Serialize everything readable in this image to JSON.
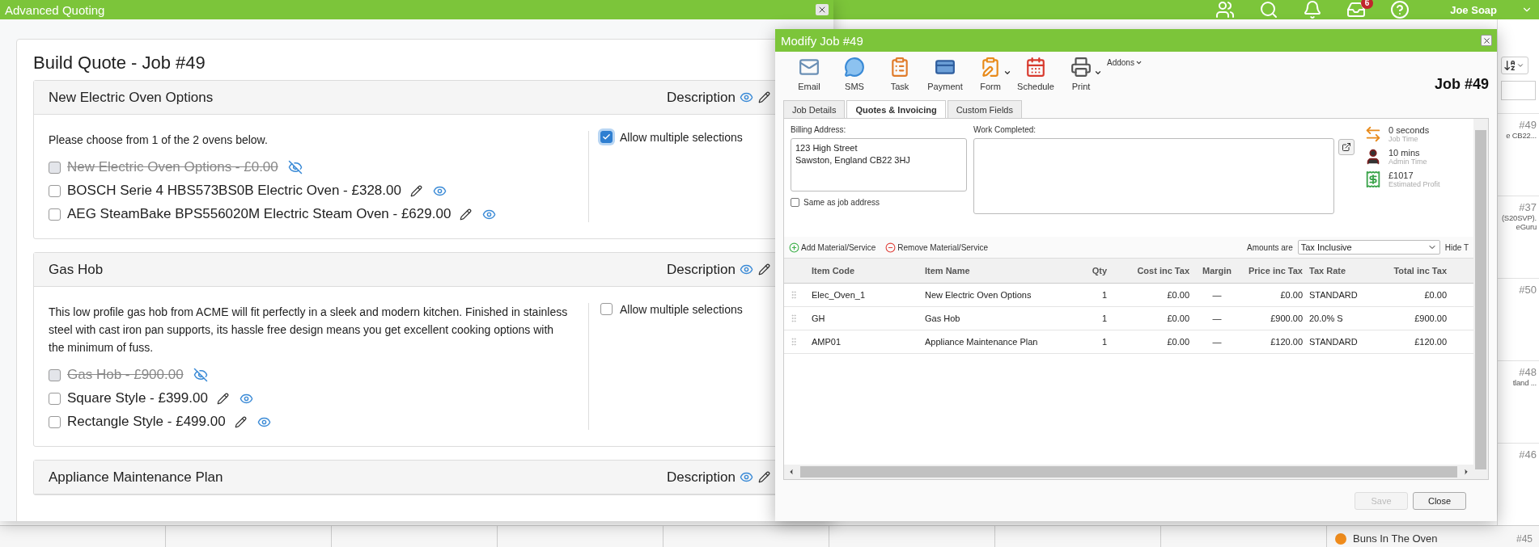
{
  "app_bar": {
    "user": "Joe Soap",
    "inbox_badge": "6"
  },
  "side_list": {
    "items": [
      {
        "number": "#49",
        "lines": [
          "e CB22..."
        ]
      },
      {
        "number": "#37",
        "lines": [
          "(S20SVP).",
          "eGuru"
        ]
      },
      {
        "number": "#50"
      },
      {
        "number": "#48",
        "lines": [
          "tland ..."
        ]
      },
      {
        "number": "#46"
      }
    ]
  },
  "calendar_footer": {
    "event": "Buns In The Oven",
    "number": "#45"
  },
  "quote_window": {
    "title": "Advanced Quoting",
    "heading": "Build Quote - Job #49",
    "sections": [
      {
        "title": "New Electric Oven Options",
        "description_label": "Description",
        "intro": "Please choose from 1 of the 2 ovens below.",
        "allow_multiple": {
          "label": "Allow multiple selections",
          "checked": true
        },
        "options": [
          {
            "label": "New Electric Oven Options - £0.00",
            "hidden": true,
            "checked": false
          },
          {
            "label": "BOSCH Serie 4 HBS573BS0B Electric Oven - £328.00",
            "hidden": false,
            "checked": false
          },
          {
            "label": "AEG SteamBake BPS556020M Electric Steam Oven - £629.00",
            "hidden": false,
            "checked": false
          }
        ]
      },
      {
        "title": "Gas Hob",
        "description_label": "Description",
        "intro": "This low profile gas hob from ACME will fit perfectly in a sleek and modern kitchen. Finished in stainless steel with cast iron pan supports, its hassle free design means you get excellent cooking options with the minimum of fuss.",
        "allow_multiple": {
          "label": "Allow multiple selections",
          "checked": false
        },
        "options": [
          {
            "label": "Gas Hob - £900.00",
            "hidden": true,
            "checked": false
          },
          {
            "label": "Square Style - £399.00",
            "hidden": false,
            "checked": false
          },
          {
            "label": "Rectangle Style - £499.00",
            "hidden": false,
            "checked": false
          }
        ]
      },
      {
        "title": "Appliance Maintenance Plan",
        "description_label": "Description"
      }
    ]
  },
  "modal": {
    "title": "Modify Job #49",
    "job_label": "Job #49",
    "toolbar": [
      {
        "label": "Email",
        "dropdown": false
      },
      {
        "label": "SMS",
        "dropdown": false
      },
      {
        "label": "Task",
        "dropdown": false
      },
      {
        "label": "Payment",
        "dropdown": false
      },
      {
        "label": "Form",
        "dropdown": true
      },
      {
        "label": "Schedule",
        "dropdown": false
      },
      {
        "label": "Print",
        "dropdown": true
      }
    ],
    "addons": "Addons",
    "tabs": [
      {
        "label": "Job Details",
        "selected": false
      },
      {
        "label": "Quotes & Invoicing",
        "selected": true
      },
      {
        "label": "Custom Fields",
        "selected": false
      }
    ],
    "billing_label": "Billing Address:",
    "billing_address": "123 High Street\nSawston, England CB22 3HJ",
    "same_as_job": {
      "label": "Same as job address",
      "checked": false
    },
    "work_label": "Work Completed:",
    "stats": [
      {
        "value": "0 seconds",
        "label": "Job Time"
      },
      {
        "value": "10 mins",
        "label": "Admin Time"
      },
      {
        "value": "£1017",
        "label": "Estimated Profit"
      }
    ],
    "add_label": "Add Material/Service",
    "remove_label": "Remove Material/Service",
    "amounts_label": "Amounts are",
    "amounts_value": "Tax Inclusive",
    "hide_label": "Hide T",
    "table": {
      "columns": [
        "Item Code",
        "Item Name",
        "Qty",
        "Cost inc Tax",
        "Margin",
        "Price inc Tax",
        "Tax Rate",
        "Total inc Tax"
      ],
      "rows": [
        [
          "Elec_Oven_1",
          "New Electric Oven Options",
          "1",
          "£0.00",
          "—",
          "£0.00",
          "STANDARD",
          "£0.00"
        ],
        [
          "GH",
          "Gas Hob",
          "1",
          "£0.00",
          "—",
          "£900.00",
          "20.0% S",
          "£900.00"
        ],
        [
          "AMP01",
          "Appliance Maintenance Plan",
          "1",
          "£0.00",
          "—",
          "£120.00",
          "STANDARD",
          "£120.00"
        ]
      ]
    },
    "buttons": [
      {
        "label": "Save",
        "disabled": true
      },
      {
        "label": "Close",
        "disabled": false
      }
    ]
  }
}
